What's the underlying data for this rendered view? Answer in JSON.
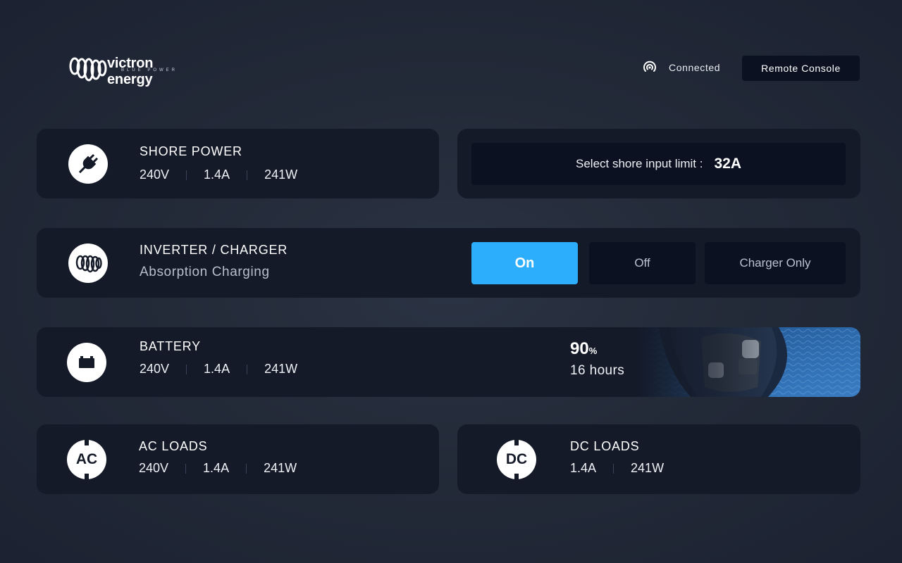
{
  "header": {
    "logo": {
      "name": "victron energy",
      "tagline": "BLUE POWER"
    },
    "connection_status": "Connected",
    "remote_console_label": "Remote Console"
  },
  "shore_power": {
    "title": "SHORE POWER",
    "voltage": "240V",
    "current": "1.4A",
    "power": "241W",
    "input_limit_label": "Select shore input limit :",
    "input_limit_value": "32A"
  },
  "inverter_charger": {
    "title": "INVERTER / CHARGER",
    "state": "Absorption Charging",
    "modes": {
      "on": "On",
      "off": "Off",
      "charger_only": "Charger Only"
    },
    "active_mode": "On"
  },
  "battery": {
    "title": "BATTERY",
    "voltage": "240V",
    "current": "1.4A",
    "power": "241W",
    "soc_value": "90",
    "soc_unit": "%",
    "time_remaining": "16 hours"
  },
  "ac_loads": {
    "title": "AC LOADS",
    "icon_label": "AC",
    "voltage": "240V",
    "current": "1.4A",
    "power": "241W"
  },
  "dc_loads": {
    "title": "DC LOADS",
    "icon_label": "DC",
    "current": "1.4A",
    "power": "241W"
  },
  "colors": {
    "accent": "#2daefc",
    "card_background": "#141a28",
    "button_background": "#0b1120",
    "page_background": "#232a38"
  },
  "icons": {
    "shore_power": "plug-icon",
    "inverter_charger": "coil-icon",
    "battery": "battery-icon",
    "ac_loads": "ac-socket-icon",
    "dc_loads": "dc-socket-icon",
    "connection": "wifi-signal-icon"
  }
}
